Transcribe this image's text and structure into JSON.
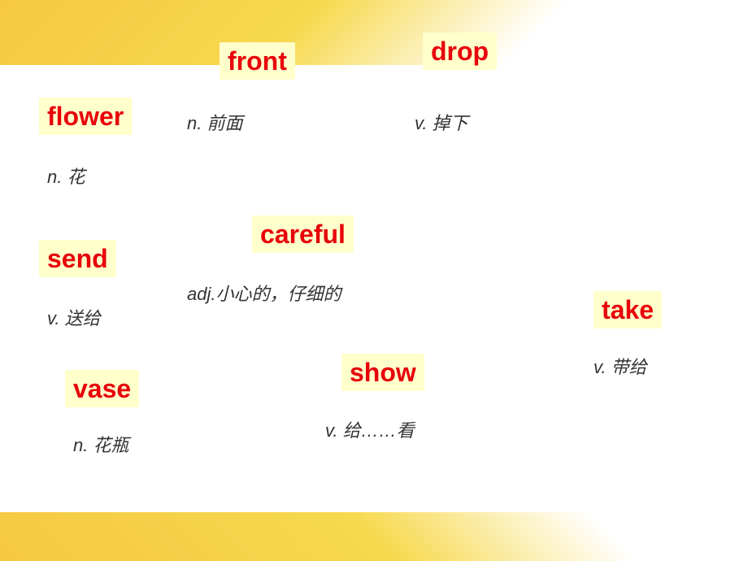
{
  "background": {
    "top_color": "#f5c842",
    "bottom_color": "#f5c842"
  },
  "words": [
    {
      "id": "flower",
      "english": "flower",
      "pos": "n.",
      "chinese": "花",
      "pos_color": "#333"
    },
    {
      "id": "front",
      "english": "front",
      "pos": "n.",
      "chinese": "前面",
      "pos_color": "#333"
    },
    {
      "id": "drop",
      "english": "drop",
      "pos": "v.",
      "chinese": "掉下",
      "pos_color": "#333"
    },
    {
      "id": "careful",
      "english": "careful",
      "pos": "adj.",
      "chinese": "小心的，仔细的",
      "pos_color": "#333"
    },
    {
      "id": "send",
      "english": "send",
      "pos": "v.",
      "chinese": "送给",
      "pos_color": "#333"
    },
    {
      "id": "take",
      "english": "take",
      "pos": "v.",
      "chinese": "带给",
      "pos_color": "#333"
    },
    {
      "id": "show",
      "english": "show",
      "pos": "v.",
      "chinese": "给……看",
      "pos_color": "#333"
    },
    {
      "id": "vase",
      "english": "vase",
      "pos": "n.",
      "chinese": "花瓶",
      "pos_color": "#333"
    }
  ],
  "labels": {
    "flower_english": "flower",
    "flower_def": "n. 花",
    "front_english": "front",
    "front_def": "n. 前面",
    "drop_english": "drop",
    "drop_def": "v. 掉下",
    "careful_english": "careful",
    "careful_def": "adj.小心的，仔细的",
    "send_english": "send",
    "send_def": "v. 送给",
    "take_english": "take",
    "take_def": "v. 带给",
    "show_english": "show",
    "show_def": "v. 给……看",
    "vase_english": "vase",
    "vase_def": "n. 花瓶"
  }
}
